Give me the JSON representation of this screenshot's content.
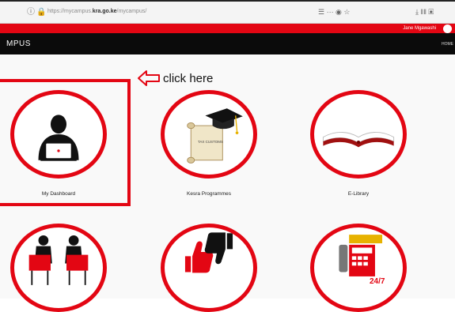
{
  "browser": {
    "url_prefix": "https://mycampus.",
    "url_domain": "kra.go.ke",
    "url_suffix": "/mycampus/",
    "page_actions": "☰ ··· ◉ ☆",
    "toolbar": "⤓ ‖‖ ▣"
  },
  "header": {
    "brand": "MPUS",
    "user_name": "Jane Mgawashi",
    "nav_right": "HOME"
  },
  "annotation": {
    "text": "click here"
  },
  "tiles": [
    {
      "label": "My Dashboard"
    },
    {
      "label": "Kesra Programmes",
      "scroll_text": "TAX CUSTOMS"
    },
    {
      "label": "E-Library"
    },
    {
      "label": ""
    },
    {
      "label": ""
    },
    {
      "label": "",
      "banner_text": "24/7"
    }
  ],
  "colors": {
    "accent": "#e30613",
    "nav": "#0b0b0b",
    "background": "#f9f9f9"
  }
}
